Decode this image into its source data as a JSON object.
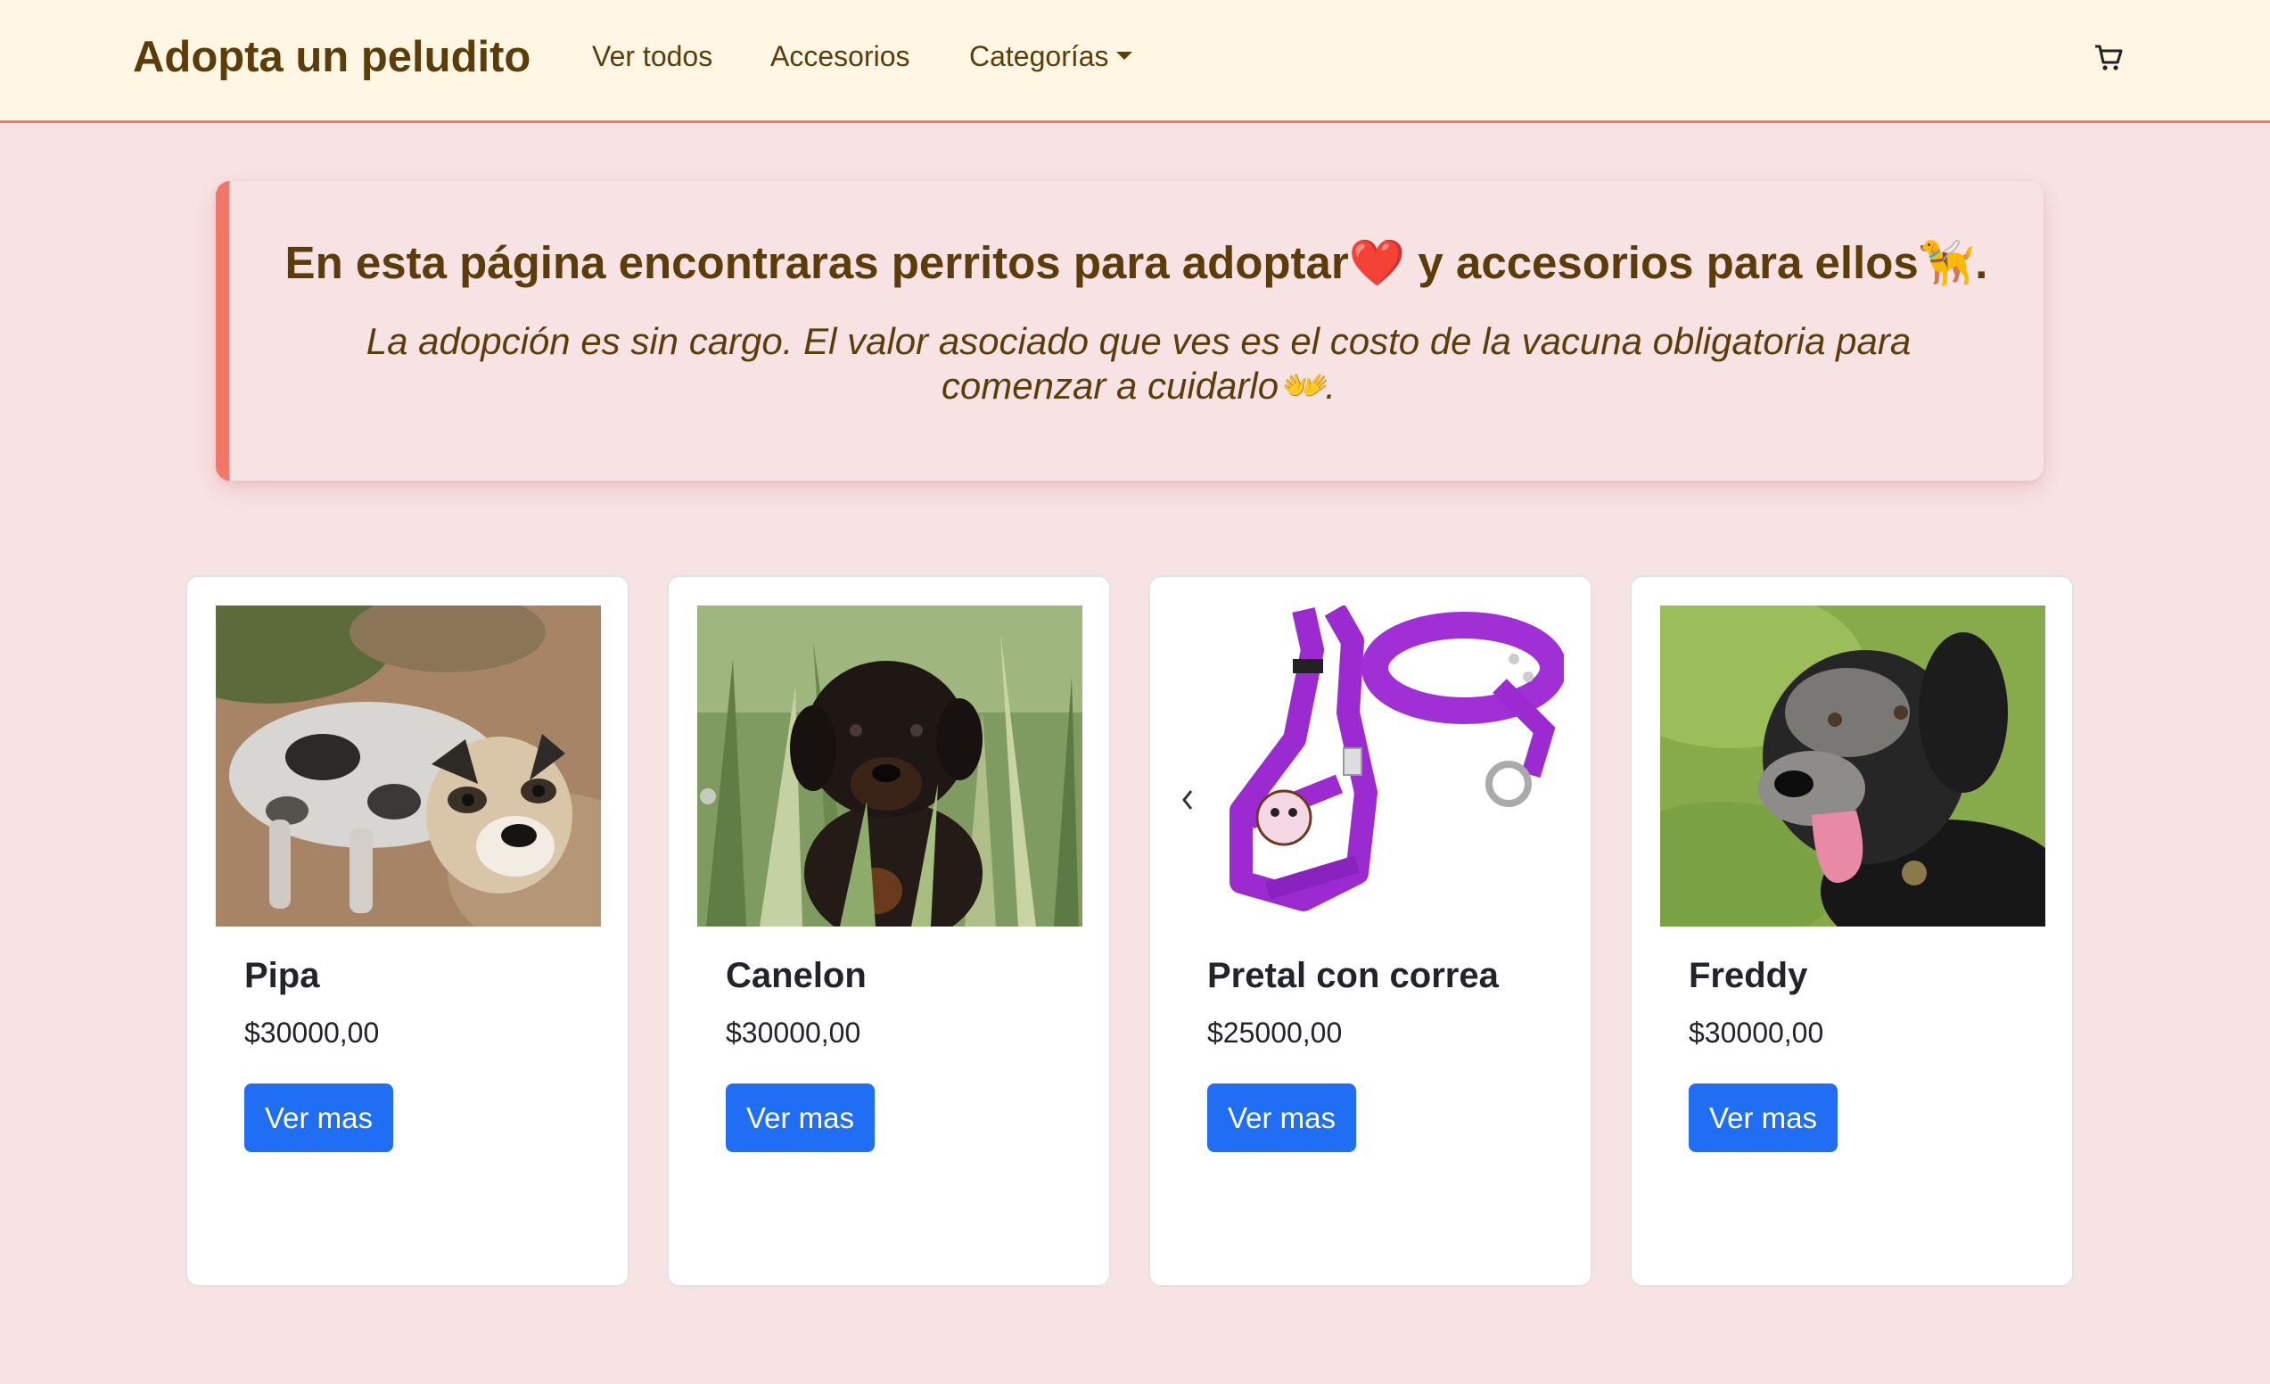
{
  "navbar": {
    "brand": "Adopta un peludito",
    "links": [
      {
        "label": "Ver todos"
      },
      {
        "label": "Accesorios"
      },
      {
        "label": "Categorías"
      }
    ],
    "cart_icon": "shopping-cart-icon"
  },
  "hero": {
    "title_a": "En esta página encontraras perritos para adoptar",
    "title_heart": "❤️",
    "title_b": " y accesorios para ellos",
    "title_dog": "🦮",
    "title_end": ".",
    "text_a": "La adopción es sin cargo. El valor asociado que ves es el costo de la vacuna obligatoria para comenzar a cuidarlo",
    "text_hands": "👐",
    "text_end": "."
  },
  "cards": [
    {
      "title": "Pipa",
      "price": "$30000,00",
      "button": "Ver mas",
      "image": "dog-photo"
    },
    {
      "title": "Canelon",
      "price": "$30000,00",
      "button": "Ver mas",
      "image": "puppy-photo"
    },
    {
      "title": "Pretal con correa",
      "price": "$25000,00",
      "button": "Ver mas",
      "image": "harness-leash-photo"
    },
    {
      "title": "Freddy",
      "price": "$30000,00",
      "button": "Ver mas",
      "image": "old-dog-photo"
    }
  ],
  "colors": {
    "page_bg": "#f8e3e4",
    "navbar_bg": "#fff6e4",
    "accent": "#f07767",
    "brand_text": "#5c3d0a",
    "button": "#1f6ef4"
  }
}
